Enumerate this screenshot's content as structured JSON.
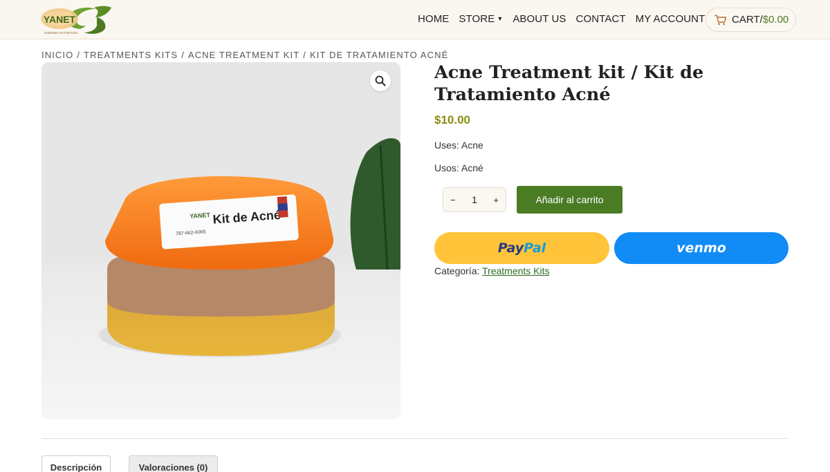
{
  "brand": {
    "logo_text": "YANET",
    "logo_tagline": "JABONES NATURALES"
  },
  "nav": {
    "items": [
      {
        "label": "HOME"
      },
      {
        "label": "STORE",
        "has_dropdown": true
      },
      {
        "label": "ABOUT US"
      },
      {
        "label": "CONTACT"
      },
      {
        "label": "MY ACCOUNT"
      }
    ],
    "cart_label": "CART/",
    "cart_amount": "$0.00"
  },
  "breadcrumb": [
    "INICIO",
    "TREATMENTS KITS",
    "ACNE TREATMENT KIT",
    "KIT DE TRATAMIENTO ACNÉ"
  ],
  "product": {
    "title": "Acne Treatment kit / Kit de Tratamiento Acné",
    "price": "$10.00",
    "uses_en": "Uses: Acne",
    "uses_es": "Usos: Acné",
    "quantity": "1",
    "qty_minus": "−",
    "qty_plus": "+",
    "add_to_cart": "Añadir al carrito",
    "paypal_pay": "Pay",
    "paypal_pal": "Pal",
    "venmo": "venmo",
    "category_label": "Categoría: ",
    "category_value": "Treatments Kits",
    "image_label": {
      "logo": "YANET",
      "phone": "787-662-6065",
      "name": "Kit de Acné"
    }
  },
  "tabs": [
    {
      "label": "Descripción"
    },
    {
      "label": "Valoraciones (0)"
    }
  ],
  "colors": {
    "accent_green": "#4a7c24",
    "price_olive": "#8a8d12",
    "paypal_yellow": "#ffc43a",
    "venmo_blue": "#118cf6",
    "header_bg": "#faf7f1"
  },
  "icons": [
    "cart-icon",
    "search-zoom-icon",
    "caret-down-icon"
  ]
}
